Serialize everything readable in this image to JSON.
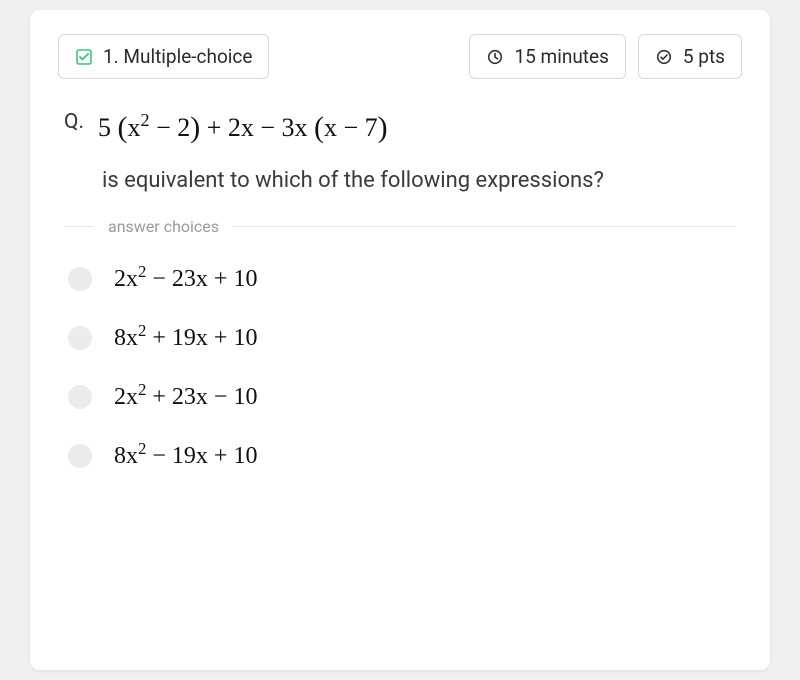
{
  "header": {
    "type_label": "1. Multiple-choice",
    "time_label": "15 minutes",
    "points_label": "5 pts"
  },
  "question": {
    "prefix": "Q.",
    "expression_html": "5 <span class=\"paren\">(</span>x<span class=\"expo\">2</span> − 2<span class=\"paren\">)</span> + 2x − 3x <span class=\"paren\">(</span>x − 7<span class=\"paren\">)</span>",
    "prompt_text": "is equivalent to which of the following expressions?"
  },
  "choices_label": "answer choices",
  "choices": [
    {
      "html": "2x<span class=\"expo\">2</span> − 23x + 10"
    },
    {
      "html": "8x<span class=\"expo\">2</span> + 19x + 10"
    },
    {
      "html": "2x<span class=\"expo\">2</span> + 23x − 10"
    },
    {
      "html": "8x<span class=\"expo\">2</span> − 19x + 10"
    }
  ]
}
